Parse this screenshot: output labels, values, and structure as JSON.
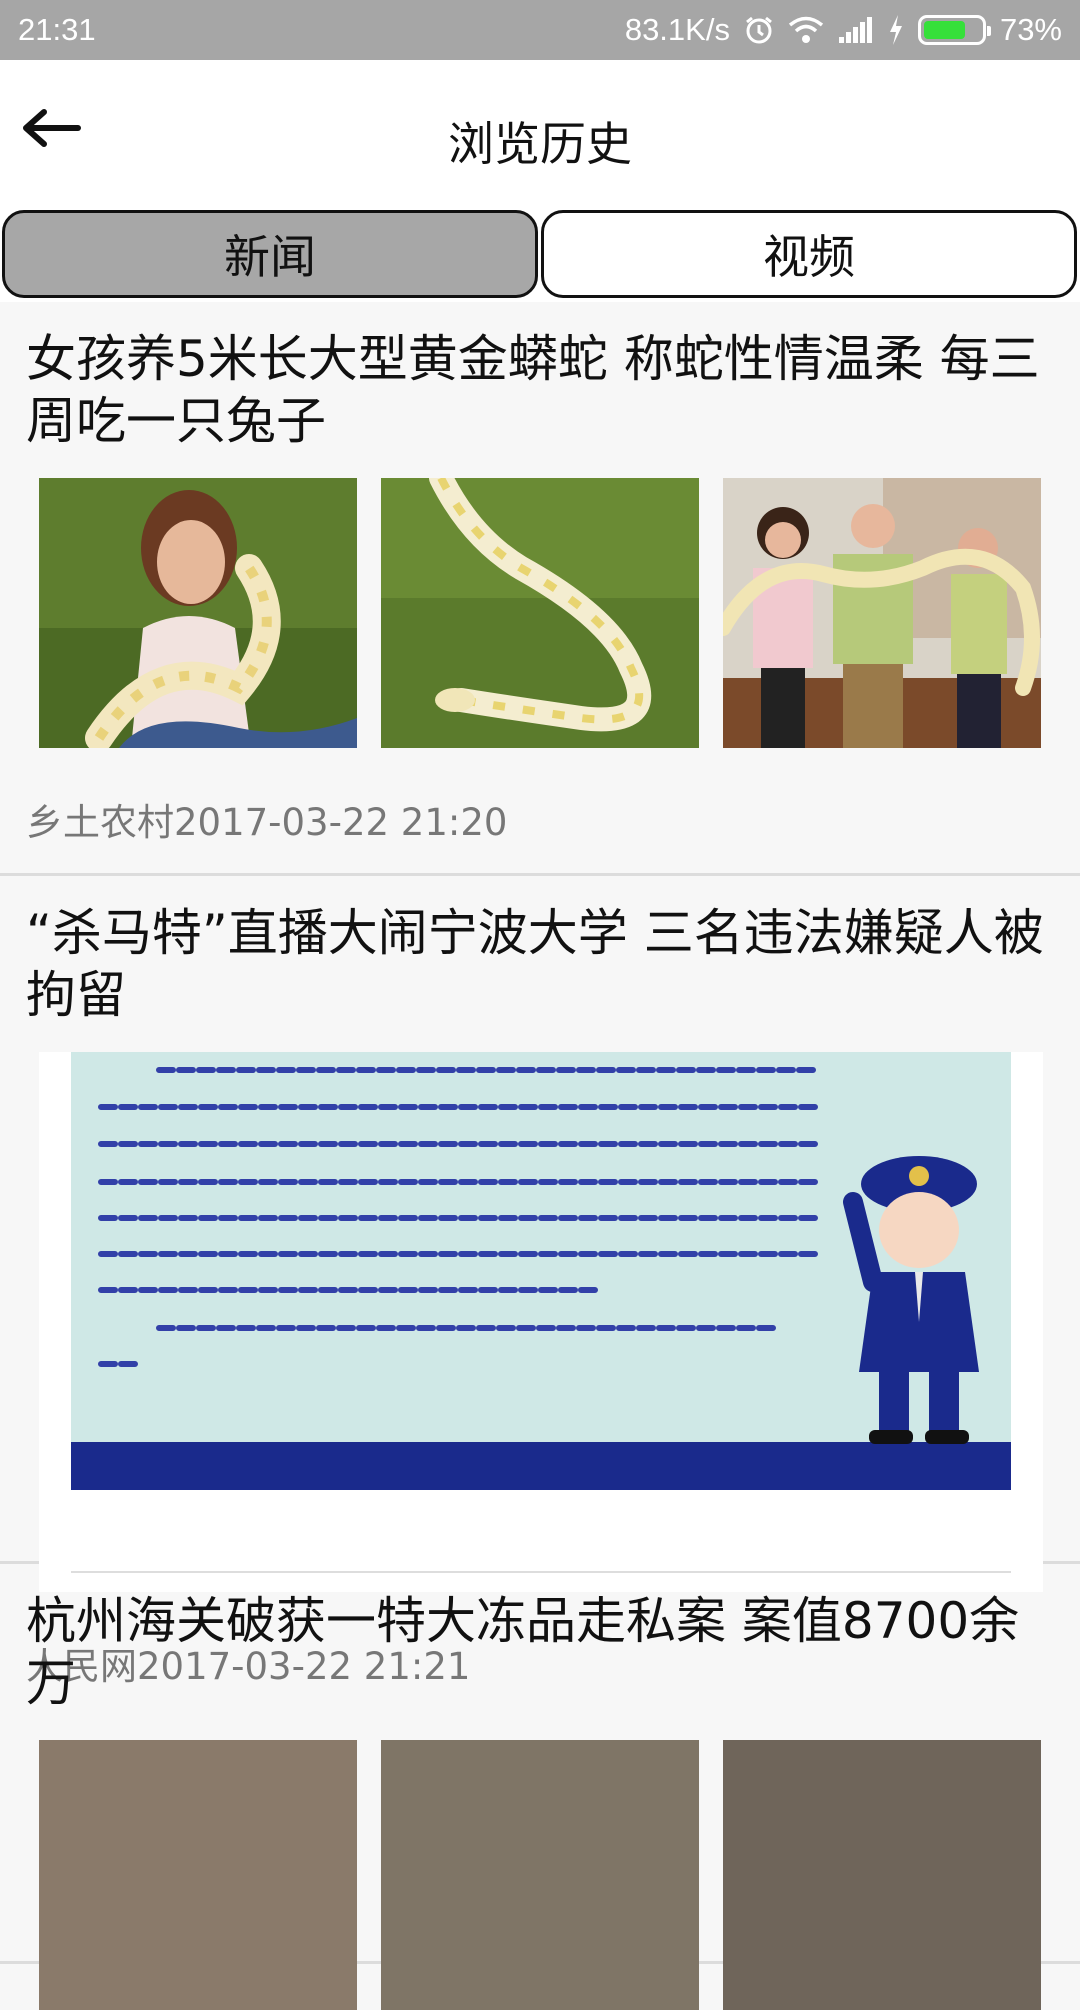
{
  "status_bar": {
    "time": "21:31",
    "network_speed": "83.1K/s",
    "battery_percent": "73%",
    "battery_level": 0.73,
    "icons": [
      "alarm-icon",
      "wifi-icon",
      "signal-icon",
      "charging-icon",
      "battery-icon"
    ]
  },
  "app_bar": {
    "back_icon": "arrow-left-icon",
    "title": "浏览历史"
  },
  "tabs": [
    {
      "label": "新闻",
      "selected": true
    },
    {
      "label": "视频",
      "selected": false
    }
  ],
  "articles": [
    {
      "title": "女孩养5米长大型黄金蟒蛇 称蛇性情温柔 每三周吃一只兔子",
      "images": [
        "girl-holding-python",
        "python-on-grass",
        "family-holding-python"
      ],
      "meta": "乡土农村2017-03-22 21:20"
    },
    {
      "title": "“杀马特”直播大闹宁波大学 三名违法嫌疑人被拘留",
      "images": [
        "police-notice-graphic"
      ],
      "meta": "人民网2017-03-22 21:21"
    },
    {
      "title": "杭州海关破获一特大冻品走私案 案值8700余万",
      "images": [
        "photo-1",
        "photo-2",
        "photo-3"
      ]
    }
  ],
  "colors": {
    "status_bar": "#a6a6a6",
    "tab_selected": "#a7a7a7",
    "notice_blue": "#1a2a8c",
    "notice_bg": "#cfe8e6"
  }
}
